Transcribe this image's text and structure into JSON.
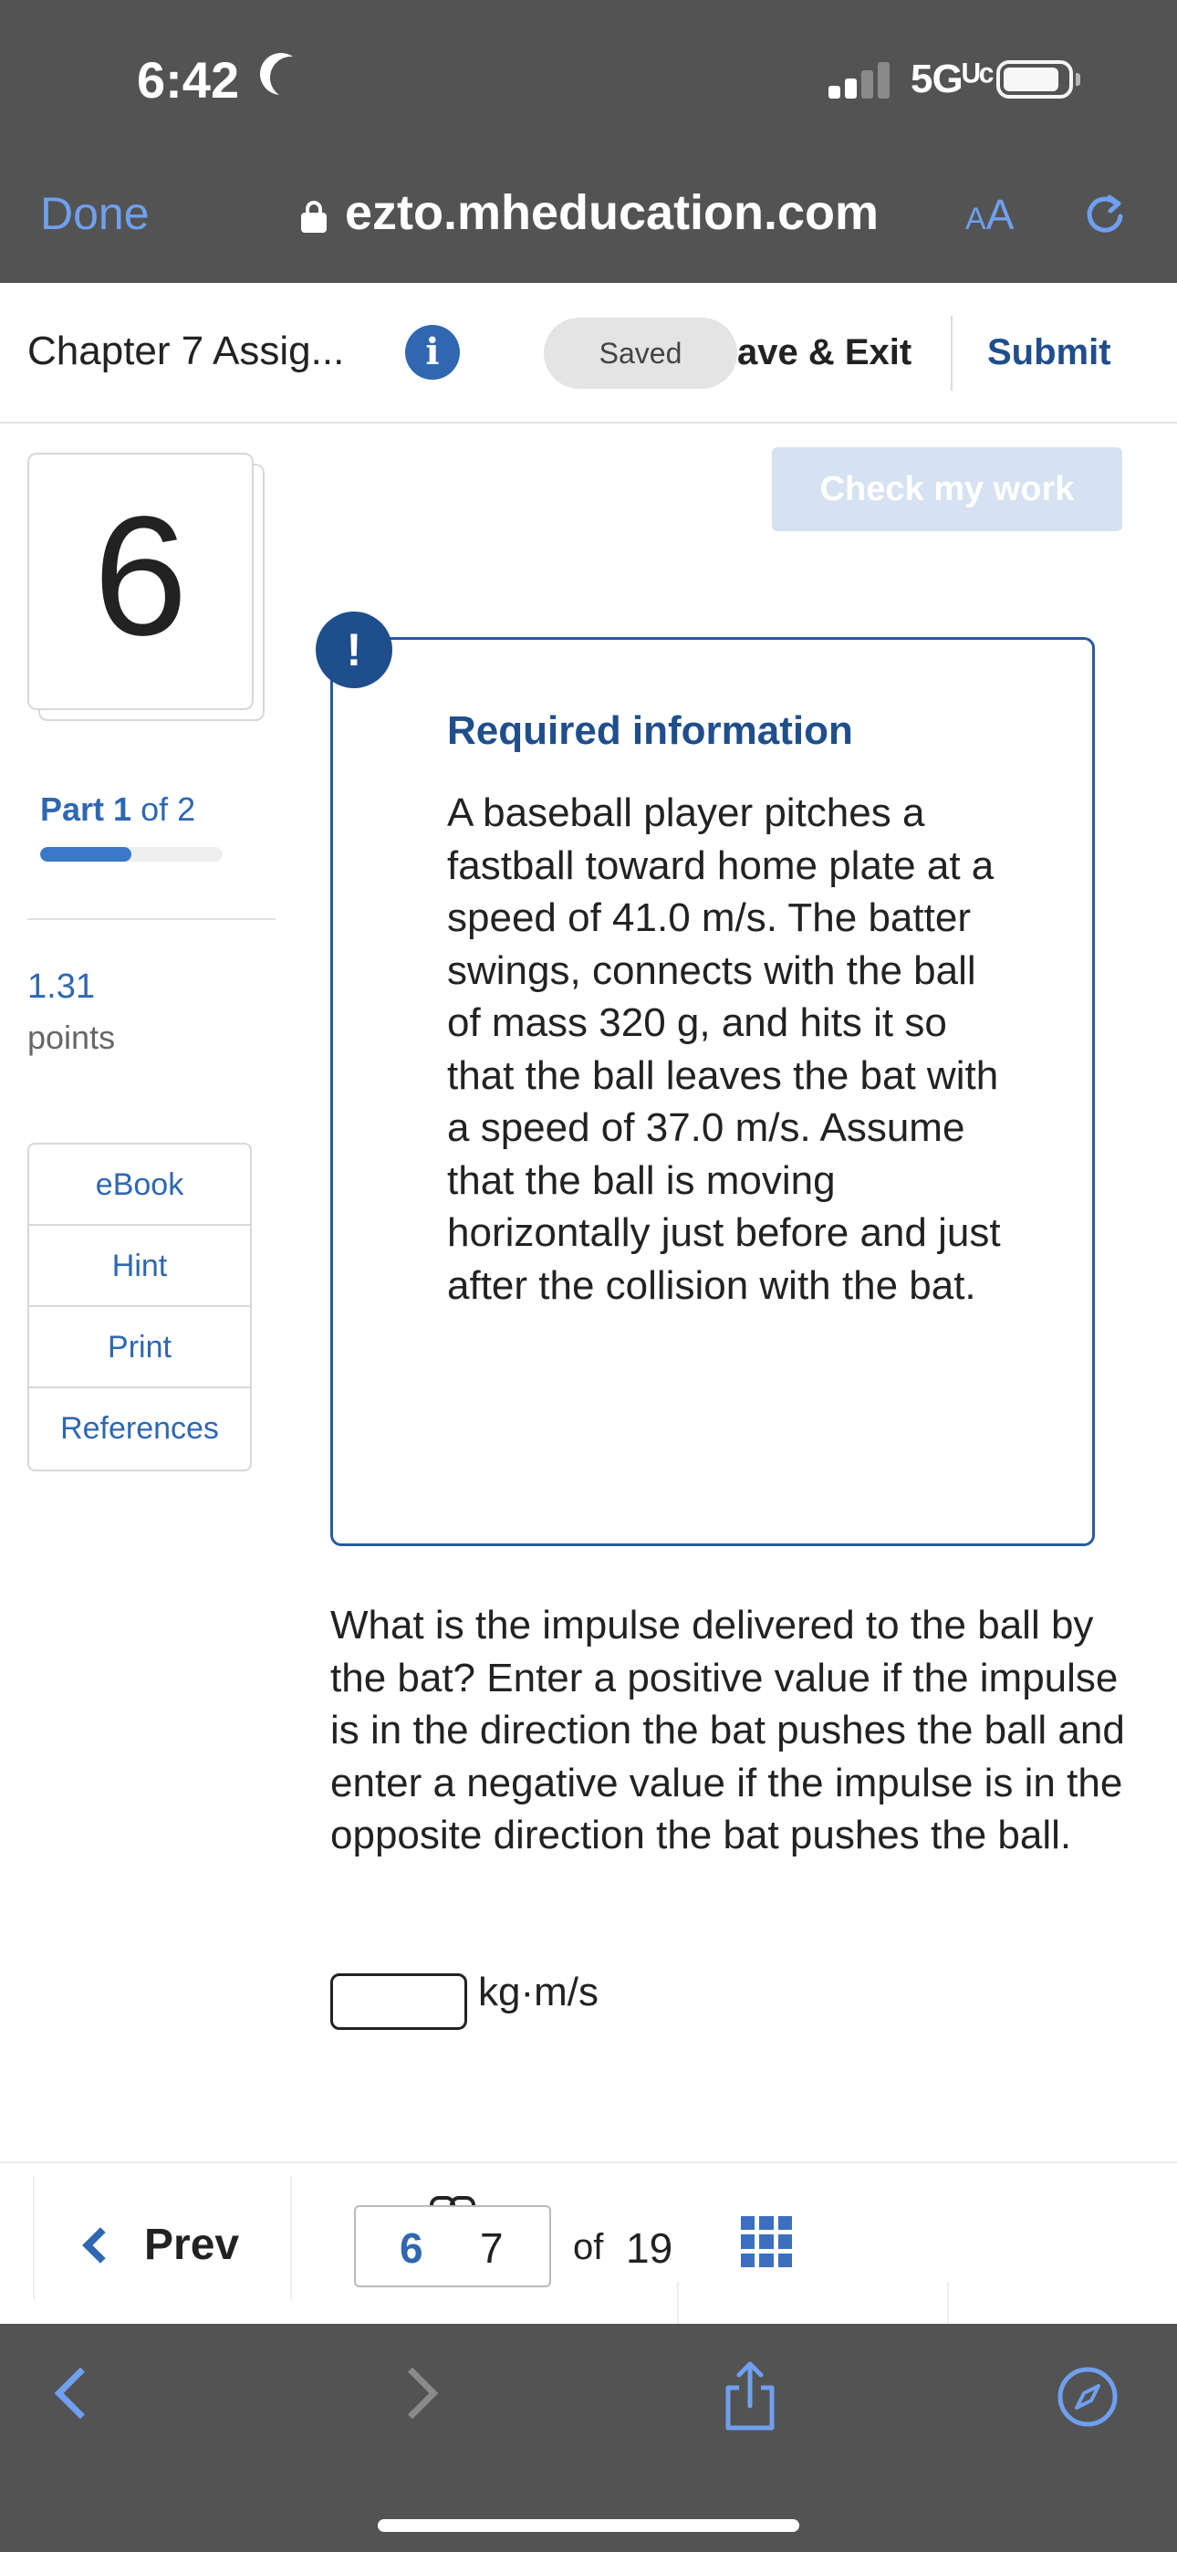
{
  "status_bar": {
    "time": "6:42",
    "network": "5Gᵁᶜ",
    "icons": [
      "moon-icon",
      "signal-icon",
      "battery-icon"
    ]
  },
  "browser": {
    "done_label": "Done",
    "url": "ezto.mheducation.com",
    "text_size_label": "AA",
    "icons": [
      "lock-icon",
      "reload-icon"
    ]
  },
  "assignment_header": {
    "title": "Chapter 7 Assig...",
    "saved_label": "Saved",
    "save_exit_label": "ave & Exit",
    "submit_label": "Submit"
  },
  "sidebar": {
    "question_number": "6",
    "part_label_prefix": "Part",
    "part_current": "1",
    "part_suffix": "of 2",
    "part_progress_fraction": 0.5,
    "points_value": "1.31",
    "points_label": "points",
    "resources": [
      "eBook",
      "Hint",
      "Print",
      "References"
    ]
  },
  "main": {
    "check_work_label": "Check my work",
    "alert_symbol": "!",
    "required_title": "Required information",
    "required_body": "A baseball player pitches a fastball toward home plate at a speed of 41.0 m/s. The batter swings, connects with the ball of mass 320 g, and hits it so that the ball leaves the bat with a speed of 37.0 m/s. Assume that the ball is moving horizontally just before and just after the collision with the bat.",
    "question": "What is the impulse delivered to the ball by the bat? Enter a positive value if the impulse is in the direction the bat pushes the ball and  enter a negative value if the impulse is in the opposite direction the bat pushes the ball.",
    "answer_value": "",
    "answer_unit": "kg·m/s"
  },
  "question_nav": {
    "prev_label": "Prev",
    "current": "6",
    "next": "7",
    "of_label": "of",
    "total": "19"
  },
  "toolbar": {
    "icons": [
      "back-icon",
      "forward-icon",
      "share-icon",
      "compass-icon"
    ]
  },
  "colors": {
    "chrome_gray": "#535353",
    "link_blue": "#2f67b1",
    "navy": "#1f4e8c",
    "safari_blue": "#6fa0f0",
    "check_button_bg": "#d6e2f1"
  }
}
